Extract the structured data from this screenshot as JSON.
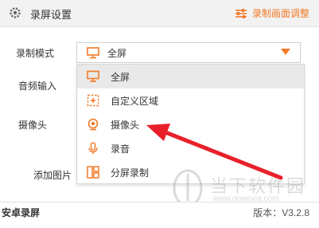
{
  "header": {
    "title": "录屏设置",
    "right_link": "录制画面调整"
  },
  "rows": {
    "mode_label": "录制模式",
    "audio_label": "音频输入",
    "camera_label": "摄像头",
    "add_image_label": "添加图片"
  },
  "select": {
    "value": "全屏"
  },
  "menu": {
    "items": [
      {
        "label": "全屏",
        "icon": "monitor-icon"
      },
      {
        "label": "自定义区域",
        "icon": "region-select-icon"
      },
      {
        "label": "摄像头",
        "icon": "webcam-icon"
      },
      {
        "label": "录音",
        "icon": "microphone-icon"
      },
      {
        "label": "分屏录制",
        "icon": "split-screen-icon"
      }
    ],
    "selected_index": 0
  },
  "footer": {
    "app_name": "安卓录屏",
    "version": "版本：V3.2.8"
  },
  "watermark": {
    "text": "当下软件园",
    "sub": "www.downxia.com"
  },
  "colors": {
    "accent": "#f37a27",
    "arrow": "#e8202a",
    "selected_bg": "#e9e9e9"
  }
}
